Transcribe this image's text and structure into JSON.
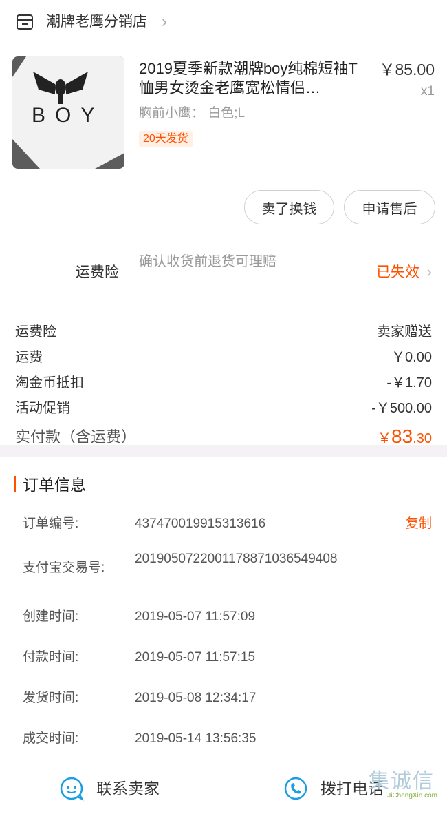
{
  "shop": {
    "icon": "shop-icon",
    "name": "潮牌老鹰分销店",
    "chevron": "›"
  },
  "product": {
    "image_text": "BOY",
    "title": "2019夏季新款潮牌boy纯棉短袖T恤男女烫金老鹰宽松情侣…",
    "sku": "胸前小鹰： 白色;L",
    "shipping_badge": "20天发货",
    "price": "￥85.00",
    "quantity": "x1"
  },
  "actions": {
    "sell_label": "卖了换钱",
    "after_sale_label": "申请售后"
  },
  "insurance": {
    "label": "运费险",
    "description": "确认收货前退货可理赔",
    "status": "已失效",
    "chevron": "›"
  },
  "fees": [
    {
      "label": "运费险",
      "value": "卖家赠送"
    },
    {
      "label": "运费",
      "value": "￥0.00"
    },
    {
      "label": "淘金币抵扣",
      "value": "-￥1.70"
    },
    {
      "label": "活动促销",
      "value": "-￥500.00"
    }
  ],
  "total": {
    "label": "实付款（含运费）",
    "symbol": "￥",
    "integer": "83",
    "decimal": ".30"
  },
  "order_info": {
    "title": "订单信息",
    "copy_label": "复制",
    "rows": [
      {
        "label": "订单编号:",
        "value": "437470019915313616"
      },
      {
        "label": "支付宝交易号:",
        "value": "2019050722001178871036549408"
      },
      {
        "label": "创建时间:",
        "value": "2019-05-07 11:57:09"
      },
      {
        "label": "付款时间:",
        "value": "2019-05-07 11:57:15"
      },
      {
        "label": "发货时间:",
        "value": "2019-05-08 12:34:17"
      },
      {
        "label": "成交时间:",
        "value": "2019-05-14 13:56:35"
      }
    ]
  },
  "bottom_bar": {
    "contact_label": "联系卖家",
    "call_label": "拨打电话",
    "contact_icon": "chat-bubble-icon",
    "call_icon": "phone-icon"
  },
  "watermark": {
    "text": "JiChengXin.com",
    "logo_text": "集诚信"
  },
  "colors": {
    "accent": "#ff5000",
    "icon_blue": "#1a9fe0",
    "separator": "#f5f2f5"
  }
}
